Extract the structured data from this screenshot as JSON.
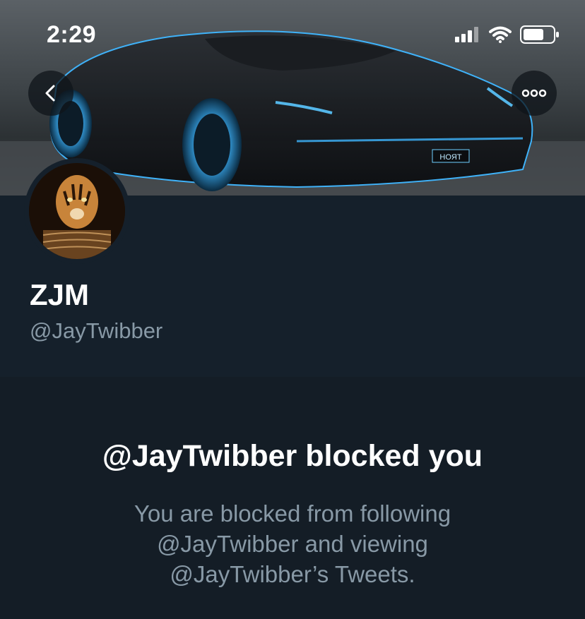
{
  "status_bar": {
    "time": "2:29",
    "icons": [
      "cellular-signal-icon",
      "wifi-icon",
      "battery-icon"
    ]
  },
  "header": {
    "back_icon": "chevron-left-icon",
    "more_icon": "more-horizontal-icon",
    "banner_plate_text": "HOЯT"
  },
  "profile": {
    "display_name": "ZJM",
    "handle": "@JayTwibber"
  },
  "blocked": {
    "title": "@JayTwibber blocked you",
    "message": "You are blocked from following @JayTwibber and viewing @JayTwibber’s Tweets."
  },
  "colors": {
    "background": "#15202b",
    "secondary_text": "#8899a6",
    "accent_glow": "#3fb6ff"
  }
}
